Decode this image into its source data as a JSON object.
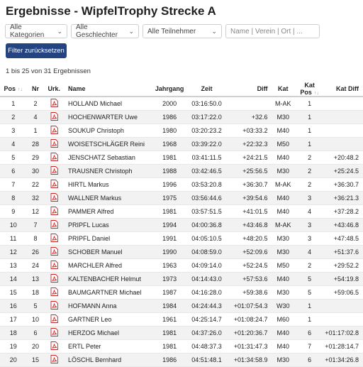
{
  "title": "Ergebnisse - WipfelTrophy Strecke A",
  "filters": {
    "category": "Alle Kategorien",
    "gender": "Alle Geschlechter",
    "participants": "Alle Teilnehmer",
    "search_placeholder": "Name | Verein | Ort | ..."
  },
  "reset_label": "Filter zurücksetzen",
  "result_count": "1 bis 25 von 31 Ergebnissen",
  "columns": {
    "pos": "Pos",
    "nr": "Nr",
    "urk": "Urk.",
    "name": "Name",
    "jahrgang": "Jahrgang",
    "zeit": "Zeit",
    "diff": "Diff",
    "kat": "Kat",
    "katpos": "Kat Pos",
    "katdiff": "Kat Diff"
  },
  "icons": {
    "certificate": "pdf-icon",
    "sort": "sort-arrows-icon",
    "dropdown": "chevron-down-icon"
  },
  "colors": {
    "reset_button": "#234381",
    "pdf_red": "#d32f2f"
  },
  "rows": [
    {
      "pos": "1",
      "nr": "2",
      "name": "HOLLAND Michael",
      "jahrgang": "2000",
      "zeit": "03:16:50.0",
      "diff": "",
      "kat": "M-AK",
      "katpos": "1",
      "katdiff": ""
    },
    {
      "pos": "2",
      "nr": "4",
      "name": "HOCHENWARTER Uwe",
      "jahrgang": "1986",
      "zeit": "03:17:22.0",
      "diff": "+32.6",
      "kat": "M30",
      "katpos": "1",
      "katdiff": ""
    },
    {
      "pos": "3",
      "nr": "1",
      "name": "SOUKUP Christoph",
      "jahrgang": "1980",
      "zeit": "03:20:23.2",
      "diff": "+03:33.2",
      "kat": "M40",
      "katpos": "1",
      "katdiff": ""
    },
    {
      "pos": "4",
      "nr": "28",
      "name": "WOISETSCHLÄGER Reini",
      "jahrgang": "1968",
      "zeit": "03:39:22.0",
      "diff": "+22:32.3",
      "kat": "M50",
      "katpos": "1",
      "katdiff": ""
    },
    {
      "pos": "5",
      "nr": "29",
      "name": "JENSCHATZ Sebastian",
      "jahrgang": "1981",
      "zeit": "03:41:11.5",
      "diff": "+24:21.5",
      "kat": "M40",
      "katpos": "2",
      "katdiff": "+20:48.2"
    },
    {
      "pos": "6",
      "nr": "30",
      "name": "TRAUSNER Christoph",
      "jahrgang": "1988",
      "zeit": "03:42:46.5",
      "diff": "+25:56.5",
      "kat": "M30",
      "katpos": "2",
      "katdiff": "+25:24.5"
    },
    {
      "pos": "7",
      "nr": "22",
      "name": "HIRTL Markus",
      "jahrgang": "1996",
      "zeit": "03:53:20.8",
      "diff": "+36:30.7",
      "kat": "M-AK",
      "katpos": "2",
      "katdiff": "+36:30.7"
    },
    {
      "pos": "8",
      "nr": "32",
      "name": "WALLNER Markus",
      "jahrgang": "1975",
      "zeit": "03:56:44.6",
      "diff": "+39:54.6",
      "kat": "M40",
      "katpos": "3",
      "katdiff": "+36:21.3"
    },
    {
      "pos": "9",
      "nr": "12",
      "name": "PAMMER Alfred",
      "jahrgang": "1981",
      "zeit": "03:57:51.5",
      "diff": "+41:01.5",
      "kat": "M40",
      "katpos": "4",
      "katdiff": "+37:28.2"
    },
    {
      "pos": "10",
      "nr": "7",
      "name": "PRIPFL Lucas",
      "jahrgang": "1994",
      "zeit": "04:00:36.8",
      "diff": "+43:46.8",
      "kat": "M-AK",
      "katpos": "3",
      "katdiff": "+43:46.8"
    },
    {
      "pos": "11",
      "nr": "8",
      "name": "PRIPFL Daniel",
      "jahrgang": "1991",
      "zeit": "04:05:10.5",
      "diff": "+48:20.5",
      "kat": "M30",
      "katpos": "3",
      "katdiff": "+47:48.5"
    },
    {
      "pos": "12",
      "nr": "26",
      "name": "SCHOBER Manuel",
      "jahrgang": "1990",
      "zeit": "04:08:59.0",
      "diff": "+52:09.6",
      "kat": "M30",
      "katpos": "4",
      "katdiff": "+51:37.6"
    },
    {
      "pos": "13",
      "nr": "24",
      "name": "MARCHLER Alfred",
      "jahrgang": "1963",
      "zeit": "04:09:14.0",
      "diff": "+52:24.5",
      "kat": "M50",
      "katpos": "2",
      "katdiff": "+29:52.2"
    },
    {
      "pos": "14",
      "nr": "13",
      "name": "KALTENBACHER Helmut",
      "jahrgang": "1973",
      "zeit": "04:14:43.0",
      "diff": "+57:53.6",
      "kat": "M40",
      "katpos": "5",
      "katdiff": "+54:19.8"
    },
    {
      "pos": "15",
      "nr": "18",
      "name": "BAUMGARTNER Michael",
      "jahrgang": "1987",
      "zeit": "04:16:28.0",
      "diff": "+59:38.6",
      "kat": "M30",
      "katpos": "5",
      "katdiff": "+59:06.5"
    },
    {
      "pos": "16",
      "nr": "5",
      "name": "HOFMANN Anna",
      "jahrgang": "1984",
      "zeit": "04:24:44.3",
      "diff": "+01:07:54.3",
      "kat": "W30",
      "katpos": "1",
      "katdiff": ""
    },
    {
      "pos": "17",
      "nr": "10",
      "name": "GARTNER Leo",
      "jahrgang": "1961",
      "zeit": "04:25:14.7",
      "diff": "+01:08:24.7",
      "kat": "M60",
      "katpos": "1",
      "katdiff": ""
    },
    {
      "pos": "18",
      "nr": "6",
      "name": "HERZOG Michael",
      "jahrgang": "1981",
      "zeit": "04:37:26.0",
      "diff": "+01:20:36.7",
      "kat": "M40",
      "katpos": "6",
      "katdiff": "+01:17:02.8"
    },
    {
      "pos": "19",
      "nr": "20",
      "name": "ERTL Peter",
      "jahrgang": "1981",
      "zeit": "04:48:37.3",
      "diff": "+01:31:47.3",
      "kat": "M40",
      "katpos": "7",
      "katdiff": "+01:28:14.7"
    },
    {
      "pos": "20",
      "nr": "15",
      "name": "LÖSCHL Bernhard",
      "jahrgang": "1986",
      "zeit": "04:51:48.1",
      "diff": "+01:34:58.9",
      "kat": "M30",
      "katpos": "6",
      "katdiff": "+01:34:26.8"
    }
  ]
}
